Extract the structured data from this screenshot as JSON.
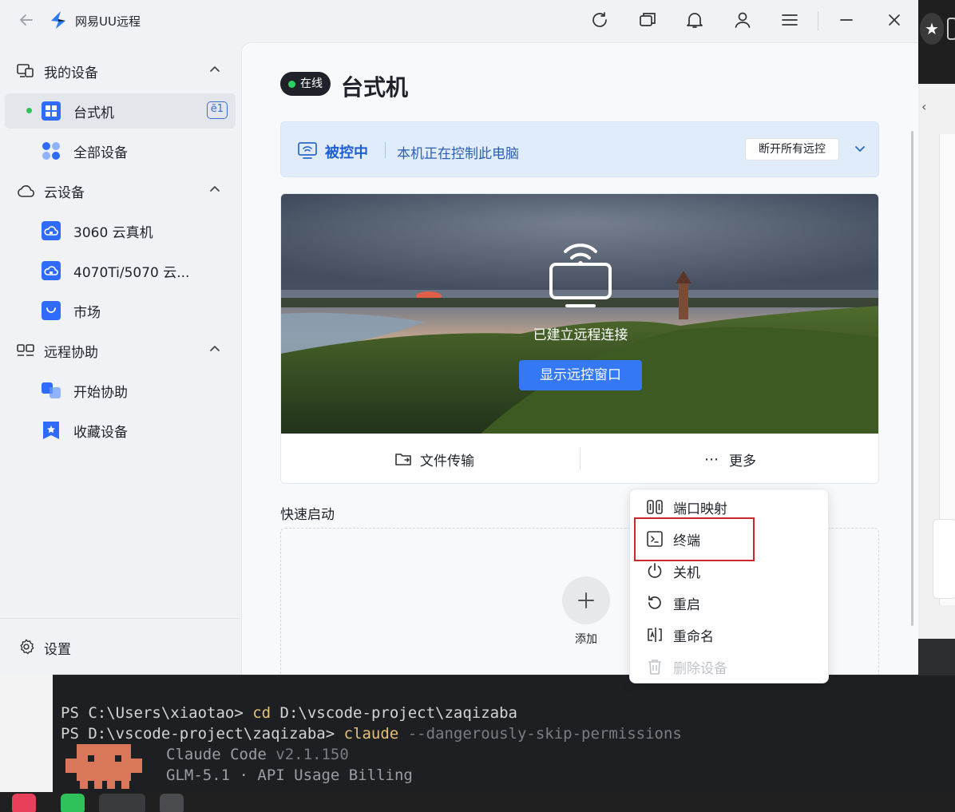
{
  "app": {
    "title": "网易UU远程"
  },
  "sidebar": {
    "groups": [
      {
        "label": "我的设备",
        "children": [
          {
            "label": "台式机",
            "badge": "ẽ1",
            "online": true
          },
          {
            "label": "全部设备"
          }
        ]
      },
      {
        "label": "云设备",
        "children": [
          {
            "label": "3060 云真机"
          },
          {
            "label": "4070Ti/5070 云..."
          },
          {
            "label": "市场"
          }
        ]
      },
      {
        "label": "远程协助",
        "children": [
          {
            "label": "开始协助"
          },
          {
            "label": "收藏设备"
          }
        ]
      }
    ],
    "settings_label": "设置"
  },
  "main": {
    "status": "在线",
    "device_title": "台式机",
    "control_banner": {
      "title": "被控中",
      "message": "本机正在控制此电脑",
      "disconnect_label": "断开所有远控"
    },
    "preview": {
      "connected_text": "已建立远程连接",
      "show_button": "显示远控窗口",
      "file_transfer": "文件传输",
      "more": "更多"
    },
    "quick_start": {
      "label": "快速启动",
      "add_label": "添加"
    }
  },
  "more_menu": {
    "items": [
      {
        "label": "端口映射",
        "icon": "port-mapping-icon"
      },
      {
        "label": "终端",
        "icon": "terminal-icon",
        "highlighted": true
      },
      {
        "label": "关机",
        "icon": "power-icon"
      },
      {
        "label": "重启",
        "icon": "restart-icon"
      },
      {
        "label": "重命名",
        "icon": "rename-icon"
      },
      {
        "label": "删除设备",
        "icon": "trash-icon",
        "disabled": true
      }
    ]
  },
  "terminal": {
    "line1_prompt": "PS C:\\Users\\xiaotao> ",
    "line1_cmd": "cd",
    "line1_arg": " D:\\vscode-project\\zaqizaba",
    "line2_prompt": "PS D:\\vscode-project\\zaqizaba> ",
    "line2_cmd": "claude",
    "line2_arg": " --dangerously-skip-permissions",
    "line3_name": "Claude Code ",
    "line3_version": "v2.1.150",
    "line4": "GLM-5.1 · API Usage Billing"
  },
  "colors": {
    "accent": "#3478f6",
    "online": "#2fc25b",
    "highlight_border": "#c9282d"
  }
}
